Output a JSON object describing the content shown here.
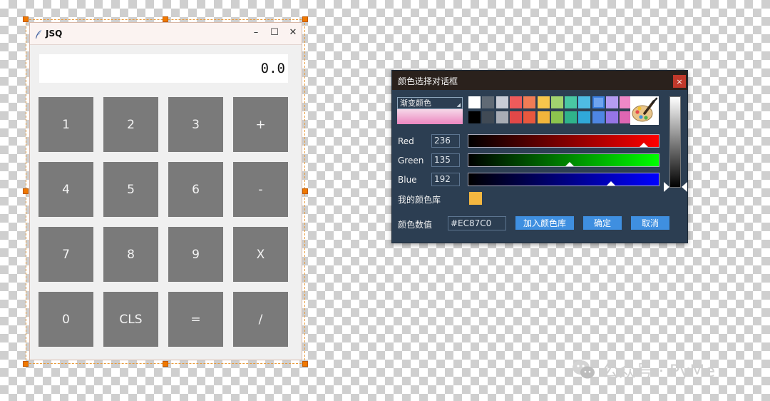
{
  "calculator": {
    "title": "JSQ",
    "display": "0.0",
    "keys": [
      "1",
      "2",
      "3",
      "+",
      "4",
      "5",
      "6",
      "-",
      "7",
      "8",
      "9",
      "X",
      "0",
      "CLS",
      "=",
      "/"
    ]
  },
  "color_dialog": {
    "title": "颜色选择对话框",
    "close_label": "×",
    "gradient_label": "渐变颜色",
    "channels": [
      {
        "label": "Red",
        "value": "236",
        "level": 0.92
      },
      {
        "label": "Green",
        "value": "135",
        "level": 0.53
      },
      {
        "label": "Blue",
        "value": "192",
        "level": 0.75
      }
    ],
    "library_label": "我的颜色库",
    "value_label": "颜色数值",
    "hex_value": "#EC87C0",
    "add_button": "加入颜色库",
    "ok_button": "确定",
    "cancel_button": "取消",
    "palette_top": [
      "#ffffff",
      "#606a75",
      "#c9ccd6",
      "#ef5b5b",
      "#f07c55",
      "#f6c64c",
      "#a2d36f",
      "#49c7a3",
      "#4fbce3",
      "#6ea4ef",
      "#b59cf2",
      "#ef88c7"
    ],
    "palette_bottom": [
      "#000000",
      "#404a55",
      "#a8acb5",
      "#e24848",
      "#e8583e",
      "#f2b53b",
      "#8cc44e",
      "#2fb38b",
      "#30a8d8",
      "#4e86e3",
      "#9575e6",
      "#de66b3"
    ],
    "selected_swatch": "#6ea4ef",
    "library_color": "#f4b740",
    "accent_color": "#3f8fe0"
  },
  "watermark": {
    "text": "公众号 · PyMe"
  }
}
